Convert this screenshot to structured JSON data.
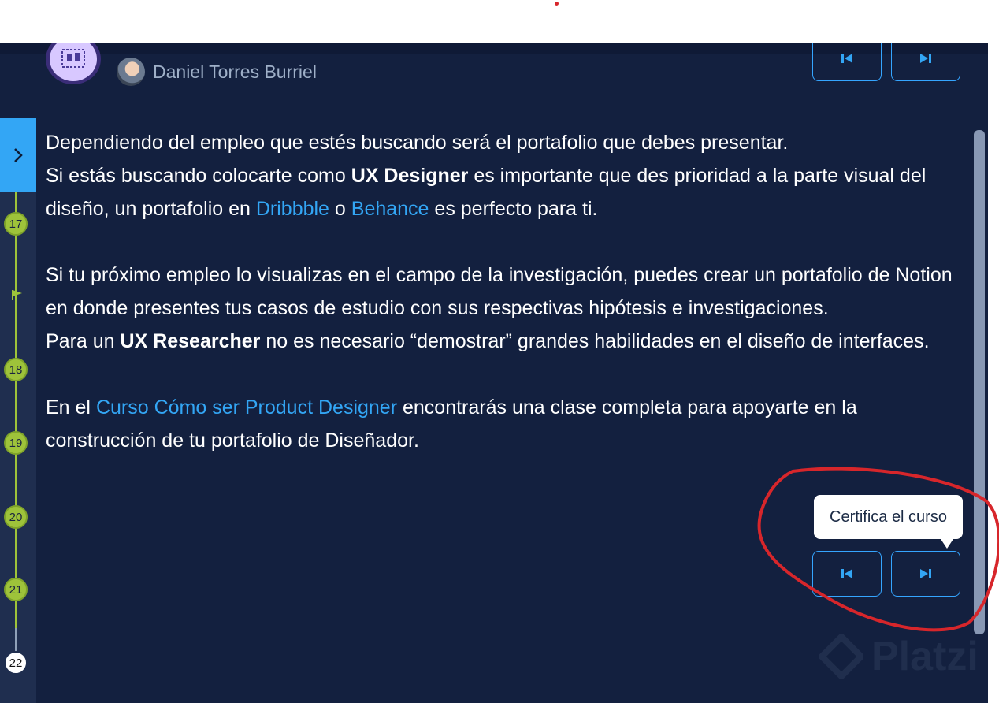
{
  "course": {
    "teacher_name": "Daniel Torres Burriel"
  },
  "content": {
    "p1": "Dependiendo del empleo que estés buscando será el portafolio que debes presentar.",
    "p2_pre": "Si estás buscando colocarte como ",
    "p2_bold": "UX Designer",
    "p2_mid": " es importante que des prioridad a la parte visual del diseño, un portafolio en ",
    "p2_link1": "Dribbble",
    "p2_o": " o ",
    "p2_link2": "Behance",
    "p2_end": " es perfecto para ti.",
    "p3": "Si tu próximo empleo lo visualizas en el campo de la investigación, puedes crear un portafolio de Notion en donde presentes tus casos de estudio con sus respectivas hipótesis e investigaciones.",
    "p4_pre": "Para un ",
    "p4_bold": "UX Researcher",
    "p4_end": " no es necesario “demostrar” grandes habilidades en el diseño de interfaces.",
    "p5_pre": "En el ",
    "p5_link": "Curso Cómo ser Product Designer",
    "p5_end": " encontrarás una clase completa para apoyarte en la construcción de tu portafolio de Diseñador."
  },
  "tooltip": {
    "text": "Certifica el curso"
  },
  "timeline": {
    "nodes": [
      "17",
      "18",
      "19",
      "20",
      "21",
      "22"
    ],
    "current": "22"
  },
  "watermark": {
    "text": "Platzi"
  },
  "colors": {
    "background": "#13203f",
    "accent": "#33a6f5",
    "progress": "#9ec33a",
    "annotation": "#d7262b"
  },
  "icons": {
    "toggle": "chevron-right-icon",
    "previous": "skip-previous-icon",
    "next": "skip-next-icon",
    "flag": "flag-icon",
    "course_badge": "course-badge-icon"
  }
}
